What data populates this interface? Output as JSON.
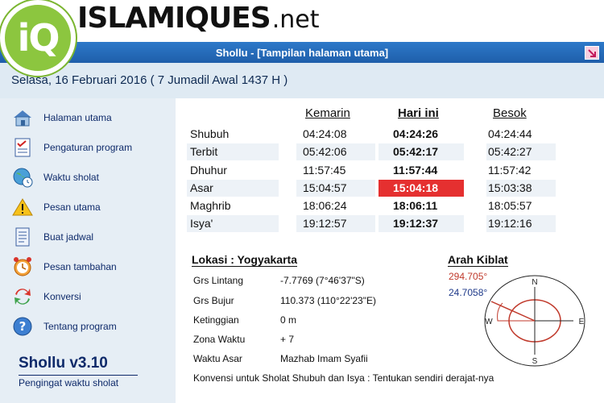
{
  "watermark": {
    "logo": "iQ",
    "brand": "ISLAMIQUES",
    "brand_suffix": ".net"
  },
  "window": {
    "title": "Shollu - [Tampilan halaman utama]"
  },
  "date_line": "Selasa, 16 Februari 2016 ( 7 Jumadil Awal 1437 H )",
  "sidebar": {
    "items": [
      {
        "label": "Halaman utama",
        "icon": "home-icon"
      },
      {
        "label": "Pengaturan program",
        "icon": "checklist-icon"
      },
      {
        "label": "Waktu sholat",
        "icon": "globe-clock-icon"
      },
      {
        "label": "Pesan utama",
        "icon": "warning-icon"
      },
      {
        "label": "Buat jadwal",
        "icon": "document-icon"
      },
      {
        "label": "Pesan tambahan",
        "icon": "alarm-clock-icon"
      },
      {
        "label": "Konversi",
        "icon": "convert-arrows-icon"
      },
      {
        "label": "Tentang program",
        "icon": "help-icon"
      }
    ],
    "version": "Shollu v3.10",
    "tagline": "Pengingat waktu sholat"
  },
  "schedule": {
    "headers": [
      "Kemarin",
      "Hari ini",
      "Besok"
    ],
    "rows": [
      {
        "name": "Shubuh",
        "kemarin": "04:24:08",
        "hari_ini": "04:24:26",
        "besok": "04:24:44"
      },
      {
        "name": "Terbit",
        "kemarin": "05:42:06",
        "hari_ini": "05:42:17",
        "besok": "05:42:27"
      },
      {
        "name": "Dhuhur",
        "kemarin": "11:57:45",
        "hari_ini": "11:57:44",
        "besok": "11:57:42"
      },
      {
        "name": "Asar",
        "kemarin": "15:04:57",
        "hari_ini": "15:04:18",
        "besok": "15:03:38"
      },
      {
        "name": "Maghrib",
        "kemarin": "18:06:24",
        "hari_ini": "18:06:11",
        "besok": "18:05:57"
      },
      {
        "name": "Isya'",
        "kemarin": "19:12:57",
        "hari_ini": "19:12:37",
        "besok": "19:12:16"
      }
    ],
    "highlight_color": "#e53030"
  },
  "location": {
    "title": "Lokasi :  Yogyakarta",
    "fields": [
      {
        "label": "Grs Lintang",
        "value": "-7.7769 (7°46'37\"S)"
      },
      {
        "label": "Grs Bujur",
        "value": "110.373 (110°22'23\"E)"
      },
      {
        "label": "Ketinggian",
        "value": "0 m"
      },
      {
        "label": "Zona Waktu",
        "value": "+ 7"
      },
      {
        "label": "Waktu Asar",
        "value": "Mazhab Imam Syafii"
      }
    ],
    "note": "Konvensi untuk Sholat Shubuh dan Isya : Tentukan sendiri derajat-nya"
  },
  "qibla": {
    "title": "Arah Kiblat",
    "degree_primary": "294.705°",
    "degree_secondary": "24.7058°",
    "compass": {
      "n": "N",
      "s": "S",
      "e": "E",
      "w": "W"
    }
  }
}
